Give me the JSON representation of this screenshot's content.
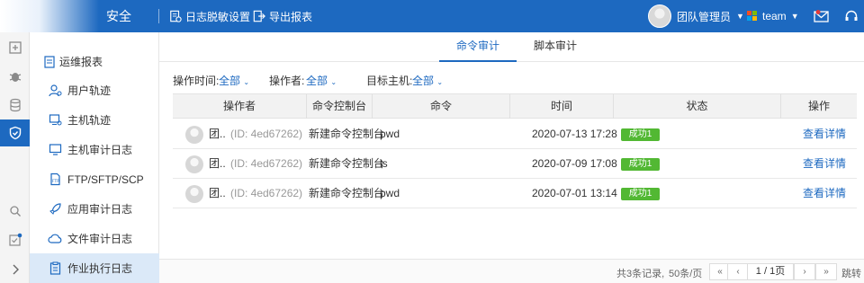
{
  "topbar": {
    "brand": "安全",
    "mask_settings": "日志脱敏设置",
    "export_report": "导出报表",
    "user_name": "团队管理员",
    "team_name": "team"
  },
  "subnav": {
    "top_item": "运维报表",
    "items": [
      {
        "label": "用户轨迹",
        "icon": "user-track-icon"
      },
      {
        "label": "主机轨迹",
        "icon": "host-track-icon"
      },
      {
        "label": "主机审计日志",
        "icon": "monitor-icon"
      },
      {
        "label": "FTP/SFTP/SCP",
        "icon": "ftp-file-icon"
      },
      {
        "label": "应用审计日志",
        "icon": "app-rocket-icon"
      },
      {
        "label": "文件审计日志",
        "icon": "cloud-file-icon"
      },
      {
        "label": "作业执行日志",
        "icon": "job-list-icon"
      }
    ]
  },
  "tabs": [
    "命令审计",
    "脚本审计"
  ],
  "filters": {
    "time_label": "操作时间:",
    "time_value": "全部",
    "operator_label": "操作者:",
    "operator_value": "全部",
    "host_label": "目标主机:",
    "host_value": "全部"
  },
  "table": {
    "headers": [
      "操作者",
      "命令控制台",
      "命令",
      "时间",
      "状态",
      "操作"
    ],
    "rows": [
      {
        "name": "团..",
        "id": "(ID: 4ed67262)",
        "console": "新建命令控制台",
        "command": "pwd",
        "time": "2020-07-13 17:28",
        "status": "成功1",
        "action": "查看详情"
      },
      {
        "name": "团..",
        "id": "(ID: 4ed67262)",
        "console": "新建命令控制台",
        "command": "ls",
        "time": "2020-07-09 17:08",
        "status": "成功1",
        "action": "查看详情"
      },
      {
        "name": "团..",
        "id": "(ID: 4ed67262)",
        "console": "新建命令控制台",
        "command": "pwd",
        "time": "2020-07-01 13:14",
        "status": "成功1",
        "action": "查看详情"
      }
    ]
  },
  "pagination": {
    "total": "共3条记录,",
    "page_size": "50条/页",
    "current": "1 / 1页",
    "jump": "跳转",
    "first": "«",
    "prev": "‹",
    "next": "›",
    "last": "»"
  },
  "colors": {
    "primary": "#1d69c0",
    "success": "#52b833",
    "active_nav": "#dbe9f8"
  }
}
